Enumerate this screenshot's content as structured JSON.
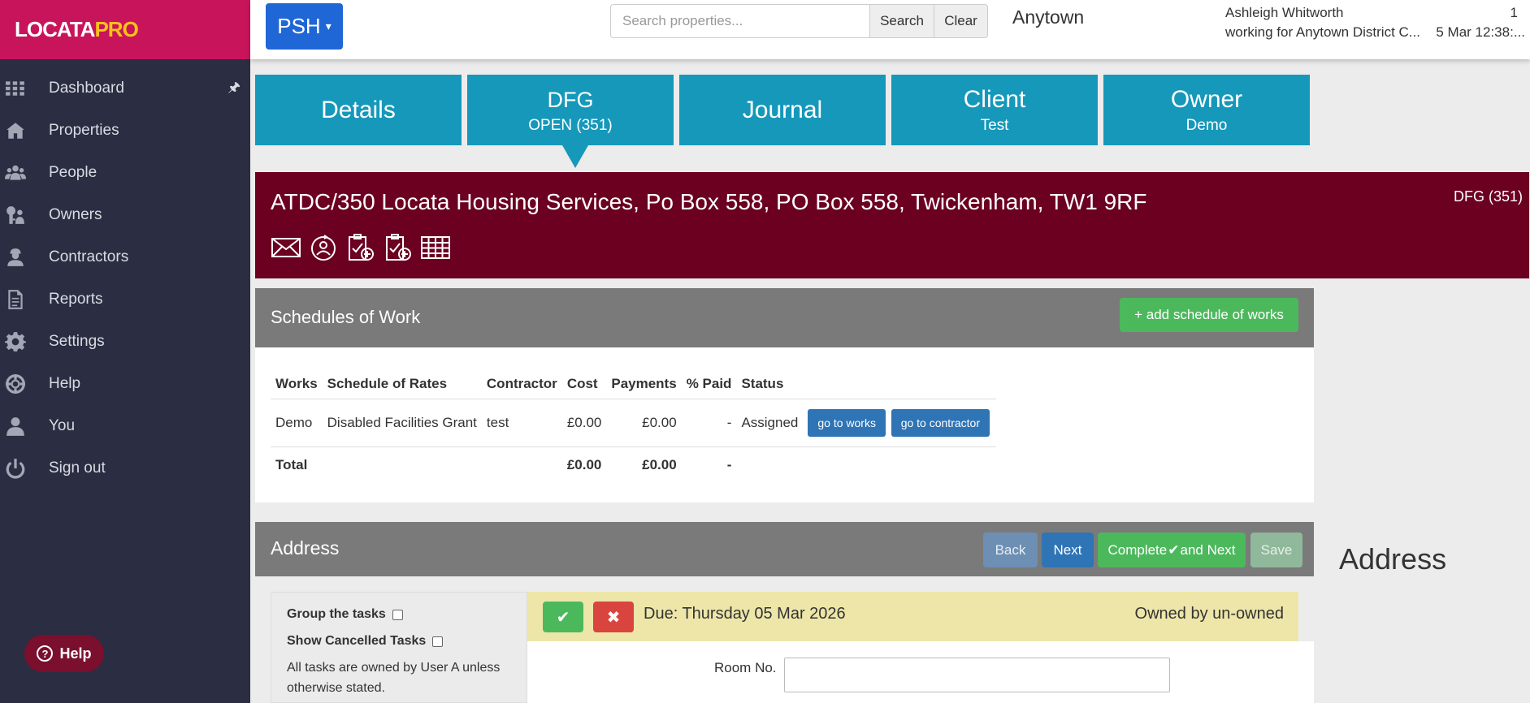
{
  "logo": {
    "part1": "LOCATA",
    "part2": "PRO"
  },
  "sidebar": {
    "items": [
      {
        "label": "Dashboard",
        "icon": "grid-icon"
      },
      {
        "label": "Properties",
        "icon": "house-icon"
      },
      {
        "label": "People",
        "icon": "people-icon"
      },
      {
        "label": "Owners",
        "icon": "owners-icon"
      },
      {
        "label": "Contractors",
        "icon": "contractor-icon"
      },
      {
        "label": "Reports",
        "icon": "report-icon"
      },
      {
        "label": "Settings",
        "icon": "gear-icon"
      },
      {
        "label": "Help",
        "icon": "lifebuoy-icon"
      },
      {
        "label": "You",
        "icon": "user-icon"
      },
      {
        "label": "Sign out",
        "icon": "power-icon"
      }
    ],
    "help_button": "Help"
  },
  "topbar": {
    "module_button": "PSH",
    "search_placeholder": "Search properties...",
    "search_label": "Search",
    "clear_label": "Clear",
    "town": "Anytown",
    "user_name": "Ashleigh Whitworth",
    "user_org": "working for Anytown District C...",
    "notification_count": "1",
    "datetime": "5 Mar 12:38:..."
  },
  "tabs": [
    {
      "title": "Details",
      "sub": ""
    },
    {
      "title": "DFG",
      "sub": "OPEN (351)"
    },
    {
      "title": "Journal",
      "sub": ""
    },
    {
      "title": "Client",
      "sub": "Test"
    },
    {
      "title": "Owner",
      "sub": "Demo"
    }
  ],
  "property": {
    "title": "ATDC/350 Locata Housing Services, Po Box 558, PO Box 558, Twickenham, TW1 9RF",
    "badge": "DFG (351)"
  },
  "schedules": {
    "title": "Schedules of Work",
    "add_label": "+ add schedule of works",
    "headers": [
      "Works",
      "Schedule of Rates",
      "Contractor",
      "Cost",
      "Payments",
      "% Paid",
      "Status"
    ],
    "rows": [
      {
        "works": "Demo",
        "rates": "Disabled Facilities Grant",
        "contractor": "test",
        "cost": "£0.00",
        "payments": "£0.00",
        "paid": "-",
        "status": "Assigned",
        "btn1": "go to works",
        "btn2": "go to contractor"
      }
    ],
    "total": {
      "label": "Total",
      "cost": "£0.00",
      "payments": "£0.00",
      "paid": "-"
    }
  },
  "address": {
    "title": "Address",
    "side_title": "Address",
    "back_label": "Back",
    "next_label": "Next",
    "complete_label_a": "Complete",
    "complete_label_b": "and Next",
    "save_label": "Save",
    "group_tasks_label": "Group the tasks",
    "show_cancelled_label": "Show Cancelled Tasks",
    "owner_note": "All tasks are owned by User A unless otherwise stated.",
    "due_text": "Due: Thursday 05 Mar 2026",
    "owned_text": "Owned by un-owned",
    "room_label": "Room No."
  },
  "colors": {
    "sidebar_bg": "#2b2d42",
    "logo_bg": "#c8145a",
    "tab_bg": "#1598ba",
    "property_bg": "#6b0021",
    "section_head_bg": "#7a7a7a",
    "success": "#4cb85c",
    "primary": "#2f74b5",
    "danger": "#d9443f",
    "task_bar_bg": "#ede6a8"
  }
}
